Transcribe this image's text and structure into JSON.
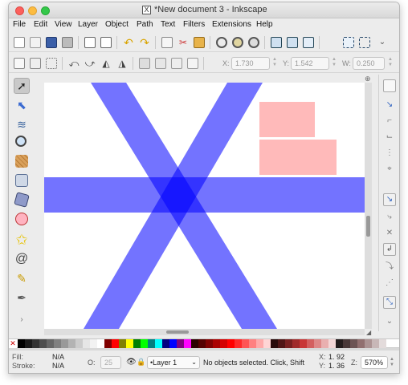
{
  "window": {
    "title": "*New document 3 - Inkscape",
    "app_icon": "X"
  },
  "menu": [
    "File",
    "Edit",
    "View",
    "Layer",
    "Object",
    "Path",
    "Text",
    "Filters",
    "Extensions",
    "Help"
  ],
  "toolbar_main": {
    "icons": [
      "new-doc-icon",
      "open-icon",
      "save-icon",
      "print-icon",
      "import-icon",
      "export-icon",
      "undo-icon",
      "redo-icon",
      "copy-icon",
      "cut-icon",
      "paste-icon",
      "zoom-selection-icon",
      "zoom-drawing-icon",
      "zoom-page-icon",
      "duplicate-icon",
      "clone-icon",
      "unlink-clone-icon",
      "group-icon",
      "ungroup-icon",
      "overflow-chevron-icon"
    ]
  },
  "toolbar_select": {
    "x_label": "X:",
    "x_value": "1.730",
    "y_label": "Y:",
    "y_value": "1.542",
    "w_label": "W:",
    "w_value": "0.250"
  },
  "tools": [
    "selector",
    "node",
    "tweak",
    "zoom",
    "measure",
    "rectangle",
    "3d-box",
    "ellipse",
    "star",
    "spiral",
    "pencil",
    "pen"
  ],
  "snap_tools": [
    "snap-enable",
    "snap-bbox",
    "snap-bbox-edge",
    "snap-bbox-corner",
    "snap-bbox-midpoint",
    "snap-bbox-center",
    "snap-nodes",
    "snap-path",
    "snap-path-intersection",
    "snap-cusp",
    "snap-smooth",
    "snap-midpoint",
    "snap-center",
    "snap-rotation",
    "snap-text",
    "snap-grid"
  ],
  "canvas": {
    "colors": {
      "blue": "#0000ff",
      "blue_opacity": 0.55,
      "pink": "#ffb3b3"
    }
  },
  "palette": {
    "colors": [
      "#000000",
      "#1a1a1a",
      "#333333",
      "#4d4d4d",
      "#666666",
      "#808080",
      "#999999",
      "#b3b3b3",
      "#cccccc",
      "#e6e6e6",
      "#f2f2f2",
      "#ffffff",
      "#800000",
      "#ff0000",
      "#808000",
      "#ffff00",
      "#008000",
      "#00ff00",
      "#008080",
      "#00ffff",
      "#000080",
      "#0000ff",
      "#800080",
      "#ff00ff",
      "#2b0000",
      "#550000",
      "#800000",
      "#aa0000",
      "#d40000",
      "#ff0000",
      "#ff2a2a",
      "#ff5555",
      "#ff8080",
      "#ffaaaa",
      "#ffd5d5",
      "#280b0b",
      "#501616",
      "#782121",
      "#a02c2c",
      "#c83737",
      "#d35f5f",
      "#de8787",
      "#e9afaf",
      "#f4d7d7",
      "#241c1c",
      "#483737",
      "#6c5353",
      "#916f6f",
      "#ac9393",
      "#c8b7b7",
      "#e3dbdb"
    ]
  },
  "status": {
    "fill_label": "Fill:",
    "fill_value": "N/A",
    "stroke_label": "Stroke:",
    "stroke_value": "N/A",
    "opacity_label": "O:",
    "opacity_value": "25",
    "layer": "•Layer 1",
    "message": "No objects selected. Click, Shift",
    "x_label": "X:",
    "x_value": "1.  92",
    "y_label": "Y:",
    "y_value": "1.  36",
    "zoom_label": "Z:",
    "zoom_value": "570%"
  }
}
